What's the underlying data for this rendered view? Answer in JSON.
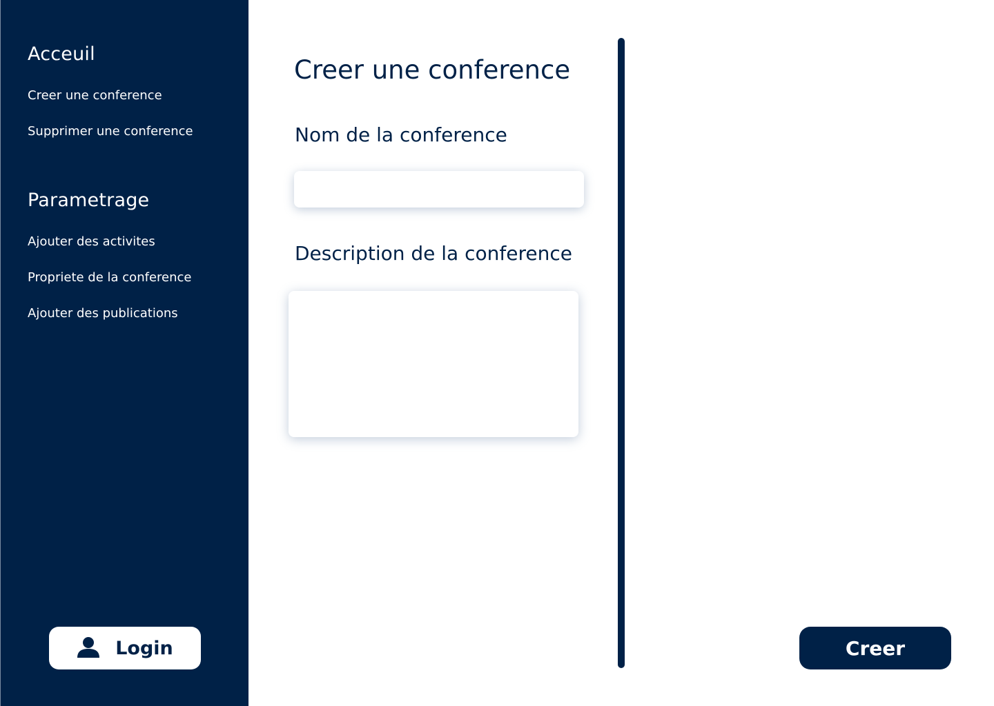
{
  "sidebar": {
    "sections": [
      {
        "heading": "Acceuil",
        "items": [
          {
            "label": "Creer une conference"
          },
          {
            "label": "Supprimer une conference"
          }
        ]
      },
      {
        "heading": "Parametrage",
        "items": [
          {
            "label": "Ajouter des activites"
          },
          {
            "label": "Propriete de la conference"
          },
          {
            "label": "Ajouter des publications"
          }
        ]
      }
    ],
    "login": {
      "label": "Login",
      "icon": "user-icon"
    }
  },
  "main": {
    "title": "Creer une conference",
    "name_field": {
      "label": "Nom de la conference",
      "value": "",
      "placeholder": ""
    },
    "description_field": {
      "label": "Description de la conference",
      "value": "",
      "placeholder": ""
    },
    "create_button": {
      "label": "Creer"
    }
  },
  "colors": {
    "primary": "#002147",
    "background": "#ffffff"
  }
}
